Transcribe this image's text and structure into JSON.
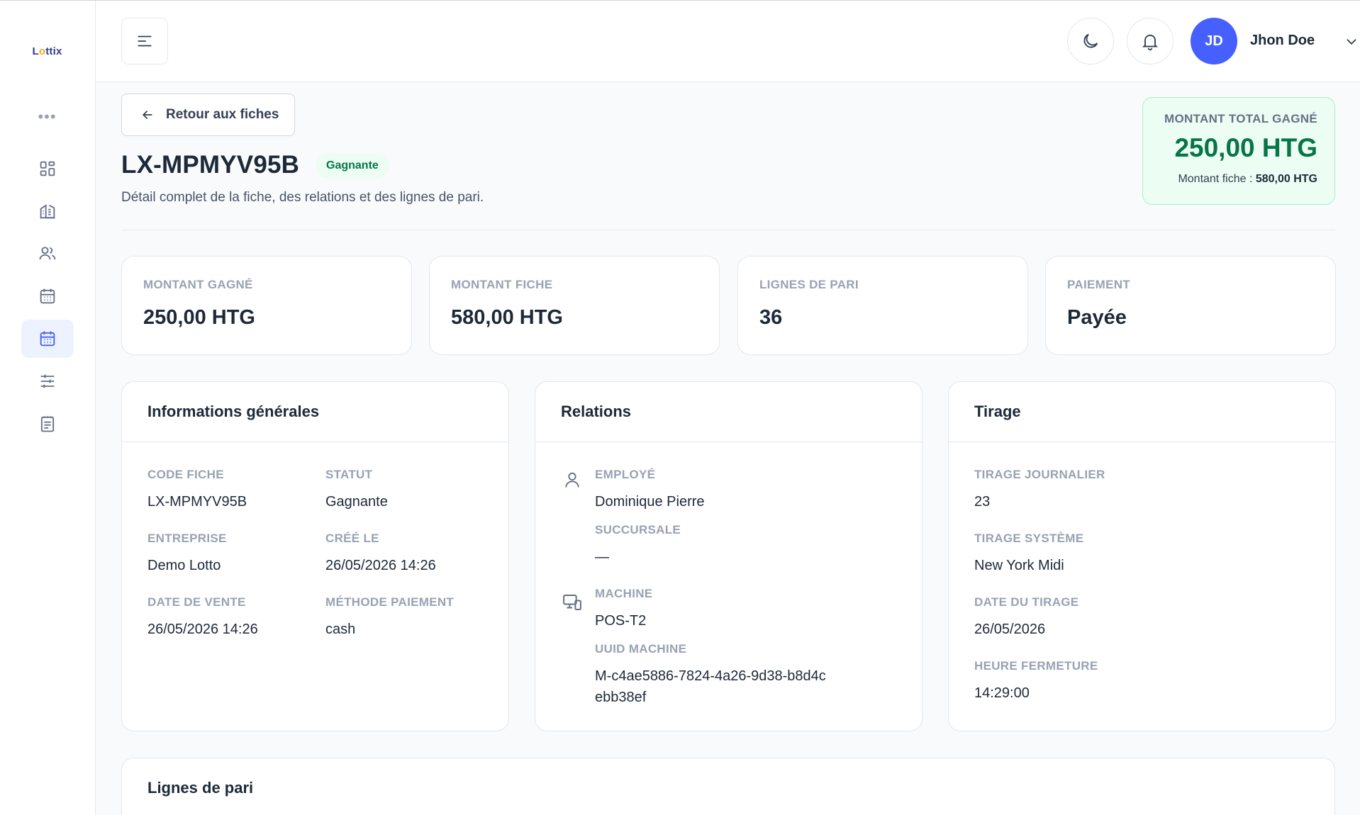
{
  "brand": {
    "logo": "Lottix"
  },
  "colors": {
    "accent": "#465fff",
    "success": "#067647",
    "success_bg": "#ecfdf3"
  },
  "sidebar": {
    "items": [
      {
        "icon": "dashboard-icon"
      },
      {
        "icon": "building-icon"
      },
      {
        "icon": "users-icon"
      },
      {
        "icon": "calendar-icon"
      },
      {
        "icon": "calendar-icon",
        "active": true
      },
      {
        "icon": "sliders-icon"
      },
      {
        "icon": "document-icon"
      }
    ]
  },
  "header": {
    "avatar_initials": "JD",
    "user_name": "Jhon Doe"
  },
  "page": {
    "back_label": "Retour aux fiches",
    "title": "LX-MPMYV95B",
    "status_badge": "Gagnante",
    "subtitle": "Détail complet de la fiche, des relations et des lignes de pari."
  },
  "total": {
    "label": "MONTANT TOTAL GAGNÉ",
    "amount": "250,00 HTG",
    "sub_label": "Montant fiche :",
    "sub_value": "580,00 HTG"
  },
  "stats": [
    {
      "label": "MONTANT GAGNÉ",
      "value": "250,00 HTG"
    },
    {
      "label": "MONTANT FICHE",
      "value": "580,00 HTG"
    },
    {
      "label": "LIGNES DE PARI",
      "value": "36"
    },
    {
      "label": "PAIEMENT",
      "value": "Payée"
    }
  ],
  "general": {
    "title": "Informations générales",
    "code_label": "CODE FICHE",
    "code_value": "LX-MPMYV95B",
    "status_label": "STATUT",
    "status_value": "Gagnante",
    "company_label": "ENTREPRISE",
    "company_value": "Demo Lotto",
    "created_label": "CRÉÉ LE",
    "created_value": "26/05/2026 14:26",
    "sale_date_label": "DATE DE VENTE",
    "sale_date_value": "26/05/2026 14:26",
    "payment_method_label": "MÉTHODE PAIEMENT",
    "payment_method_value": "cash"
  },
  "relations": {
    "title": "Relations",
    "employee_label": "EMPLOYÉ",
    "employee_value": "Dominique Pierre",
    "branch_label": "SUCCURSALE",
    "branch_value": "—",
    "machine_label": "MACHINE",
    "machine_value": "POS-T2",
    "uuid_label": "UUID MACHINE",
    "uuid_value": "M-c4ae5886-7824-4a26-9d38-b8d4cebb38ef"
  },
  "draw": {
    "title": "Tirage",
    "daily_label": "TIRAGE JOURNALIER",
    "daily_value": "23",
    "system_label": "TIRAGE SYSTÈME",
    "system_value": "New York Midi",
    "date_label": "DATE DU TIRAGE",
    "date_value": "26/05/2026",
    "close_label": "HEURE FERMETURE",
    "close_value": "14:29:00"
  },
  "bet_lines": {
    "title": "Lignes de pari"
  }
}
